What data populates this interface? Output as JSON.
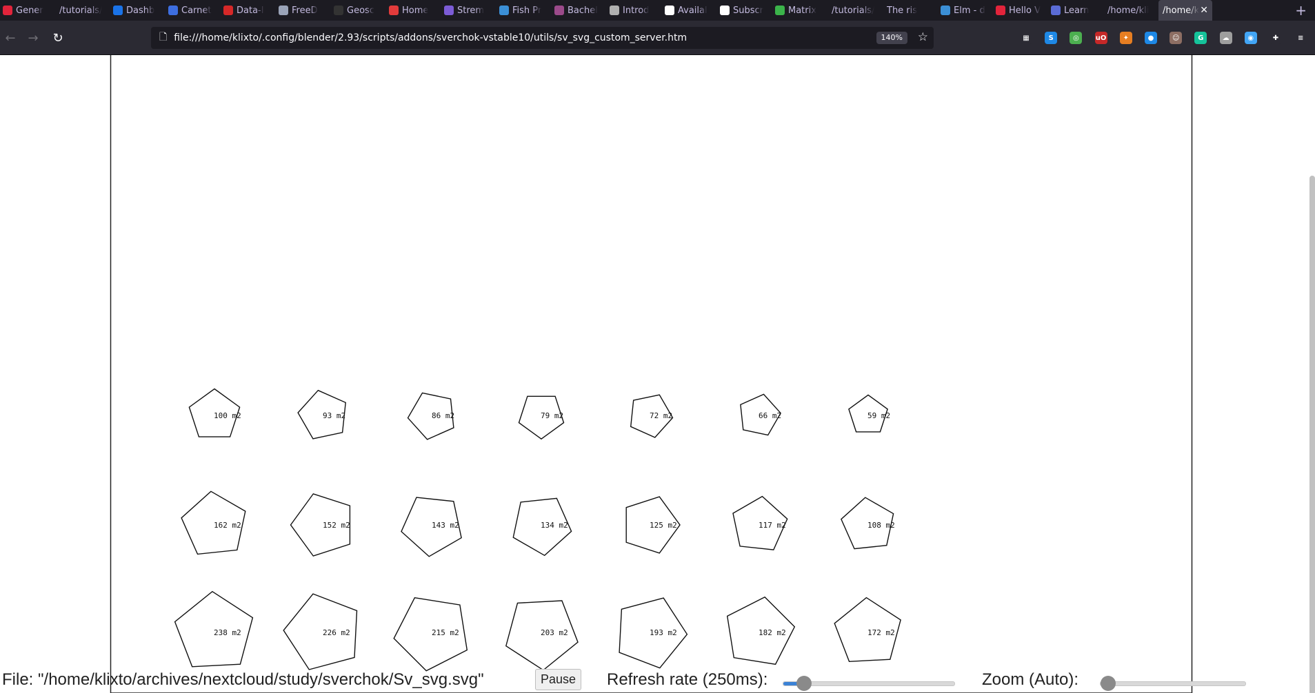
{
  "tabs": [
    {
      "label": "Gener",
      "icon_color": "#e2243b",
      "active": false
    },
    {
      "label": "/tutorials/",
      "icon_color": "",
      "active": false
    },
    {
      "label": "Dashb",
      "icon_color": "#1a73e8",
      "active": false
    },
    {
      "label": "Carnet",
      "icon_color": "#3d6ee0",
      "active": false
    },
    {
      "label": "Data-I",
      "icon_color": "#d62828",
      "active": false
    },
    {
      "label": "FreeD",
      "icon_color": "#9aa3b8",
      "active": false
    },
    {
      "label": "Geosc",
      "icon_color": "#333333",
      "active": false
    },
    {
      "label": "Home",
      "icon_color": "#e23b3b",
      "active": false
    },
    {
      "label": "Strem",
      "icon_color": "#7c5cd6",
      "active": false
    },
    {
      "label": "Fish Pr",
      "icon_color": "#3b8fd6",
      "active": false
    },
    {
      "label": "Bachel",
      "icon_color": "#9b4a8a",
      "active": false
    },
    {
      "label": "Introd",
      "icon_color": "#b0b0b0",
      "active": false
    },
    {
      "label": "Availal",
      "icon_color": "#ffffff",
      "active": false
    },
    {
      "label": "Subscr",
      "icon_color": "#ffffff",
      "active": false
    },
    {
      "label": "Matrix",
      "icon_color": "#3bb34a",
      "active": false
    },
    {
      "label": "/tutorials/",
      "icon_color": "",
      "active": false
    },
    {
      "label": "The ris",
      "icon_color": "",
      "active": false
    },
    {
      "label": "Elm - d",
      "icon_color": "#3b8fd6",
      "active": false
    },
    {
      "label": "Hello V",
      "icon_color": "#e2243b",
      "active": false
    },
    {
      "label": "Learn",
      "icon_color": "#5b6cd6",
      "active": false
    },
    {
      "label": "/home/kli",
      "icon_color": "",
      "active": false
    },
    {
      "label": "/home/k",
      "icon_color": "",
      "active": true
    }
  ],
  "new_tab_label": "+",
  "nav": {
    "url": "file:///home/klixto/.config/blender/2.93/scripts/addons/sverchok-vstable10/utils/sv_svg_custom_server.htm",
    "zoom_level": "140%"
  },
  "extensions": [
    {
      "name": "apps-icon",
      "color": "#2b2a33",
      "glyph": "▦"
    },
    {
      "name": "s-extension-icon",
      "color": "#1e88e5",
      "glyph": "S"
    },
    {
      "name": "sync-extension-icon",
      "color": "#4caf50",
      "glyph": "◎"
    },
    {
      "name": "ublock-icon",
      "color": "#c62828",
      "glyph": "uO"
    },
    {
      "name": "puzzle-extension-icon",
      "color": "#e67e22",
      "glyph": "✦"
    },
    {
      "name": "pin-extension-icon",
      "color": "#1e88e5",
      "glyph": "●"
    },
    {
      "name": "avatar-extension-icon",
      "color": "#8d6e63",
      "glyph": "☺"
    },
    {
      "name": "grammarly-icon",
      "color": "#15c39a",
      "glyph": "G"
    },
    {
      "name": "cloud-extension-icon",
      "color": "#9e9e9e",
      "glyph": "☁"
    },
    {
      "name": "globe-extension-icon",
      "color": "#42a5f5",
      "glyph": "◉"
    },
    {
      "name": "extensions-icon",
      "color": "#2b2a33",
      "glyph": "✚"
    },
    {
      "name": "menu-icon",
      "color": "#2b2a33",
      "glyph": "≡"
    }
  ],
  "svg_grid": {
    "rows": [
      [
        "100 m2",
        "93 m2",
        "86 m2",
        "79 m2",
        "72 m2",
        "66 m2",
        "59 m2"
      ],
      [
        "162 m2",
        "152 m2",
        "143 m2",
        "134 m2",
        "125 m2",
        "117 m2",
        "108 m2"
      ],
      [
        "238 m2",
        "226 m2",
        "215 m2",
        "203 m2",
        "193 m2",
        "182 m2",
        "172 m2"
      ]
    ],
    "areas": [
      [
        100,
        93,
        86,
        79,
        72,
        66,
        59
      ],
      [
        162,
        152,
        143,
        134,
        125,
        117,
        108
      ],
      [
        238,
        226,
        215,
        203,
        193,
        182,
        172
      ]
    ],
    "rotations_deg": [
      [
        0,
        -12,
        -24,
        -36,
        -48,
        -60,
        -72
      ],
      [
        -6,
        -18,
        -30,
        -42,
        -54,
        -66,
        -78
      ],
      [
        -3,
        -15,
        -27,
        -39,
        -51,
        -63,
        -75
      ]
    ]
  },
  "controls": {
    "file_label": "File: \"/home/klixto/archives/nextcloud/study/sverchok/Sv_svg.svg\"",
    "pause_label": "Pause",
    "refresh_label": "Refresh rate (250ms):",
    "refresh_fraction": 0.12,
    "zoom_label": "Zoom (Auto):",
    "zoom_fraction": 0.0
  }
}
